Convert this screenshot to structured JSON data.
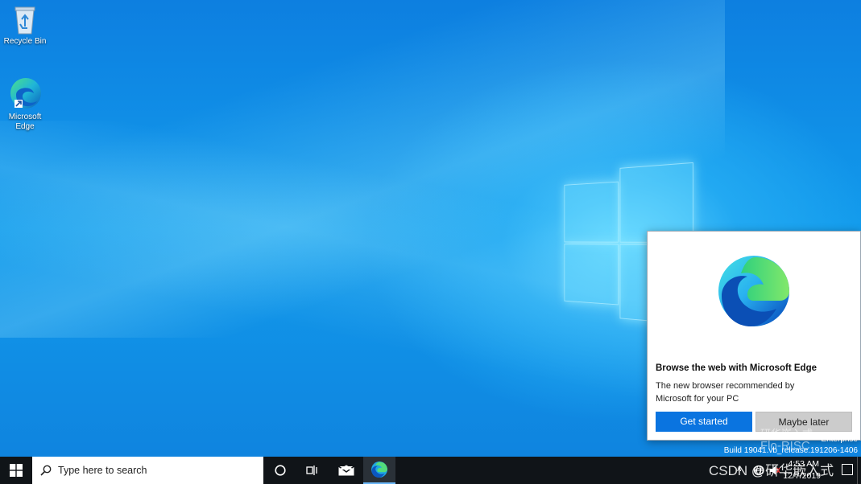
{
  "desktop": {
    "icons": [
      {
        "label": "Recycle Bin"
      },
      {
        "label": "Microsoft Edge"
      }
    ],
    "build_line1": "Enterprise",
    "build_line2": "Build 19041.vb_release.191206-1406"
  },
  "toast": {
    "title": "Browse the web with Microsoft Edge",
    "body": "The new browser recommended by Microsoft for your PC",
    "primary_button": "Get started",
    "secondary_button": "Maybe later"
  },
  "taskbar": {
    "search_placeholder": "Type here to search",
    "time": "4:53 AM",
    "date": "12/7/2019"
  },
  "watermark": {
    "line1": "研华嵌入式",
    "line2": "Flo-RISC",
    "csdn": "CSDN @研华嵌入式"
  },
  "colors": {
    "accent": "#0a74e0",
    "taskbar": "#101418"
  }
}
